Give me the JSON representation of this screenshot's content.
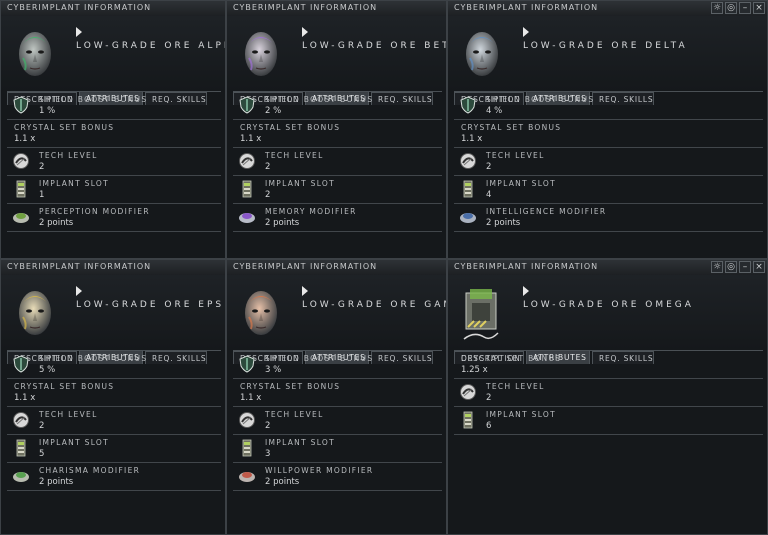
{
  "window_title": "CYBERIMPLANT INFORMATION",
  "window_buttons": [
    "☼",
    "◎",
    "–",
    "×"
  ],
  "tabs": {
    "description": "DESCRIPTION",
    "attributes": "ATTRIBUTES",
    "req_skills": "REQ. SKILLS"
  },
  "windows": [
    {
      "item_name": "LOW-GRADE ORE ALPHA",
      "colors": {
        "accent": "#3fb56a",
        "skin": "#bfc6c2"
      },
      "attributes": [
        {
          "label": "SHIELD BOOST BONUS",
          "value": "1 %",
          "icon": "shield-icon"
        },
        {
          "label": "CRYSTAL SET BONUS",
          "value": "1.1 x"
        },
        {
          "label": "TECH LEVEL",
          "value": "2",
          "icon": "tech-level-icon"
        },
        {
          "label": "IMPLANT SLOT",
          "value": "1",
          "icon": "implant-slot-icon"
        },
        {
          "label": "PERCEPTION MODIFIER",
          "value": "2 points",
          "icon": "perception-icon"
        }
      ]
    },
    {
      "item_name": "LOW-GRADE ORE BETA",
      "colors": {
        "accent": "#a070d8",
        "skin": "#d8d2dc"
      },
      "attributes": [
        {
          "label": "SHIELD BOOST BONUS",
          "value": "2 %",
          "icon": "shield-icon"
        },
        {
          "label": "CRYSTAL SET BONUS",
          "value": "1.1 x"
        },
        {
          "label": "TECH LEVEL",
          "value": "2",
          "icon": "tech-level-icon"
        },
        {
          "label": "IMPLANT SLOT",
          "value": "2",
          "icon": "implant-slot-icon"
        },
        {
          "label": "MEMORY MODIFIER",
          "value": "2 points",
          "icon": "memory-icon"
        }
      ]
    },
    {
      "item_name": "LOW-GRADE ORE DELTA",
      "colors": {
        "accent": "#5f8fc4",
        "skin": "#cfd6dc"
      },
      "attributes": [
        {
          "label": "SHIELD BOOST BONUS",
          "value": "4 %",
          "icon": "shield-icon"
        },
        {
          "label": "CRYSTAL SET BONUS",
          "value": "1.1 x"
        },
        {
          "label": "TECH LEVEL",
          "value": "2",
          "icon": "tech-level-icon"
        },
        {
          "label": "IMPLANT SLOT",
          "value": "4",
          "icon": "implant-slot-icon"
        },
        {
          "label": "INTELLIGENCE MODIFIER",
          "value": "2 points",
          "icon": "intelligence-icon"
        }
      ]
    },
    {
      "item_name": "LOW-GRADE ORE EPSILON",
      "colors": {
        "accent": "#d6b84a",
        "skin": "#e8dcb8"
      },
      "attributes": [
        {
          "label": "SHIELD BOOST BONUS",
          "value": "5 %",
          "icon": "shield-icon"
        },
        {
          "label": "CRYSTAL SET BONUS",
          "value": "1.1 x"
        },
        {
          "label": "TECH LEVEL",
          "value": "2",
          "icon": "tech-level-icon"
        },
        {
          "label": "IMPLANT SLOT",
          "value": "5",
          "icon": "implant-slot-icon"
        },
        {
          "label": "CHARISMA MODIFIER",
          "value": "2 points",
          "icon": "charisma-icon"
        }
      ]
    },
    {
      "item_name": "LOW-GRADE ORE GAMMA",
      "colors": {
        "accent": "#d9774a",
        "skin": "#e6c0a8"
      },
      "attributes": [
        {
          "label": "SHIELD BOOST BONUS",
          "value": "3 %",
          "icon": "shield-icon"
        },
        {
          "label": "CRYSTAL SET BONUS",
          "value": "1.1 x"
        },
        {
          "label": "TECH LEVEL",
          "value": "2",
          "icon": "tech-level-icon"
        },
        {
          "label": "IMPLANT SLOT",
          "value": "3",
          "icon": "implant-slot-icon"
        },
        {
          "label": "WILLPOWER MODIFIER",
          "value": "2 points",
          "icon": "willpower-icon"
        }
      ]
    },
    {
      "item_name": "LOW-GRADE ORE OMEGA",
      "colors": {
        "accent": "#7ab84a",
        "skin": "#a9b0a4"
      },
      "attributes": [
        {
          "label": "CRYSTAL SET BONUS",
          "value": "1.25 x"
        },
        {
          "label": "TECH LEVEL",
          "value": "2",
          "icon": "tech-level-icon"
        },
        {
          "label": "IMPLANT SLOT",
          "value": "6",
          "icon": "implant-slot-icon"
        }
      ]
    }
  ]
}
